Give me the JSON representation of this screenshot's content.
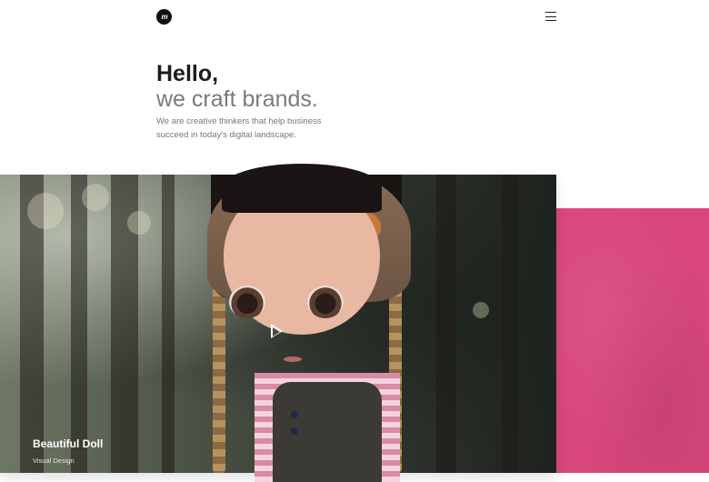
{
  "header": {
    "logo_text": "m",
    "logo_icon": "logo-icon",
    "menu_icon": "hamburger-menu-icon"
  },
  "hero": {
    "heading": "Hello,",
    "subheading": "we craft brands.",
    "description": "We are creative thinkers that help business succeed in today's digital landscape."
  },
  "feature": {
    "title": "Beautiful Doll",
    "category": "Visual Design",
    "play_icon": "play-icon"
  },
  "colors": {
    "accent_pink": "#d9477c",
    "text_dark": "#1c1c1c",
    "text_muted": "#7b7b7b"
  }
}
